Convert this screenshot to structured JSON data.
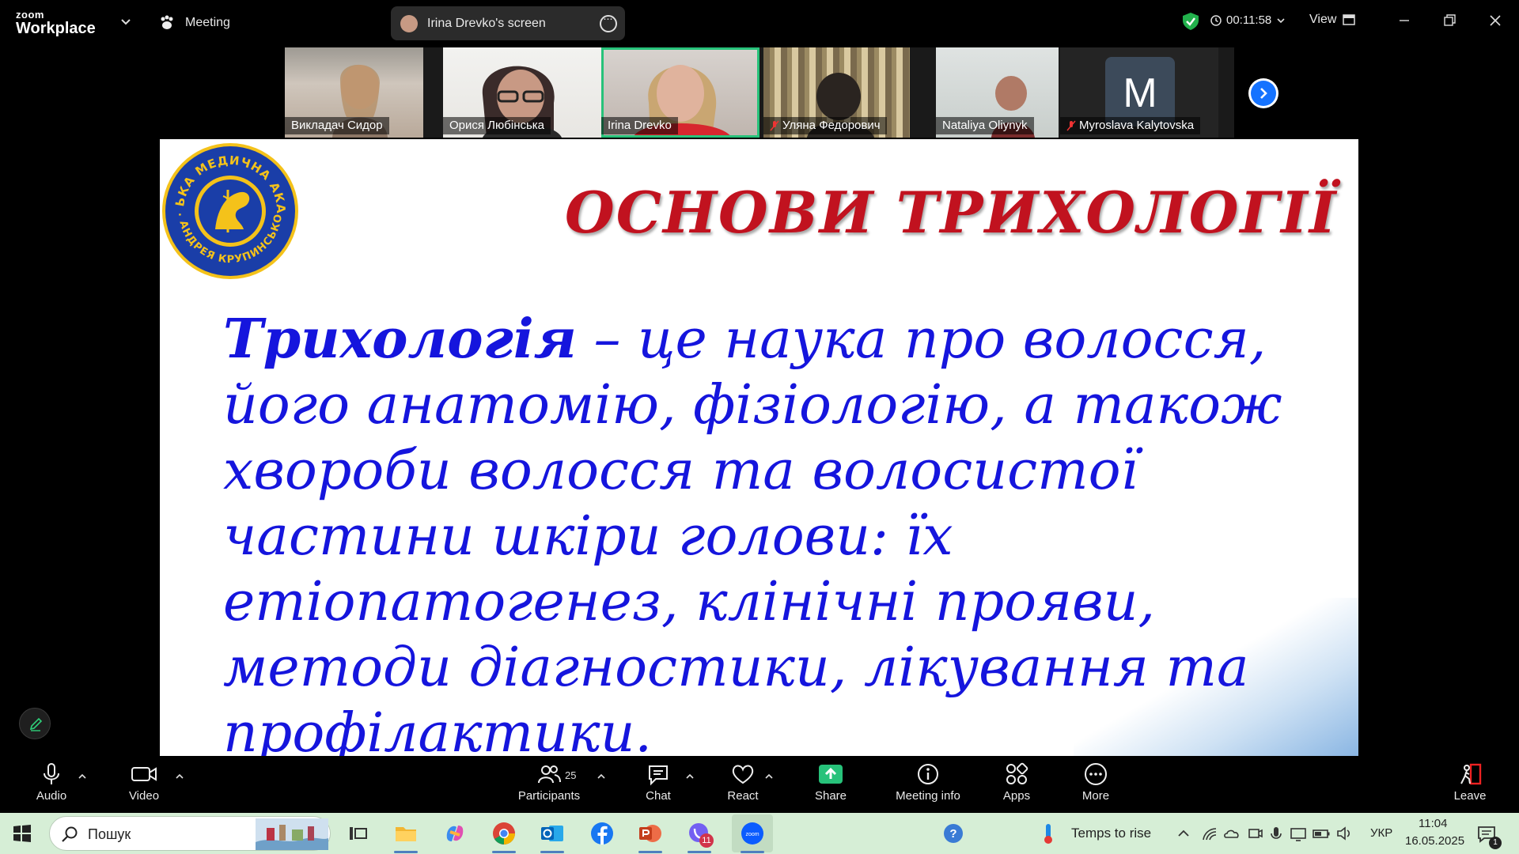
{
  "app": {
    "brand_small": "zoom",
    "brand_big": "Workplace"
  },
  "topbar": {
    "meeting_label": "Meeting",
    "screen_share_label": "Irina Drevko's screen",
    "timer": "00:11:58",
    "view_label": "View"
  },
  "participants_strip": [
    {
      "name": "Викладач Сидор",
      "muted": false,
      "active": false
    },
    {
      "name": "Орися Любінська",
      "muted": false,
      "active": false
    },
    {
      "name": "Irina Drevko",
      "muted": false,
      "active": true
    },
    {
      "name": "Уляна Федорович",
      "muted": true,
      "active": false
    },
    {
      "name": "Nataliya Oliynyk",
      "muted": false,
      "active": false
    },
    {
      "name": "Myroslava Kalytovska",
      "muted": true,
      "active": false,
      "avatar_letter": "M"
    }
  ],
  "slide": {
    "title": "ОСНОВИ ТРИХОЛОГІЇ",
    "term": "Трихологія",
    "definition_lines": [
      " –  це наука про волосся,",
      "його анатомію, фізіологію, а також",
      "хвороби волосся та волосистої",
      "частини шкіри голови: їх",
      "етіопатогенез, клінічні прояви,",
      "методи діагностики, лікування та",
      "профілактики."
    ],
    "seal_text_top": "ЛЬВІВСЬКА МЕДИЧНА АКАДЕМІЯ",
    "seal_text_bottom": "ІМ. АНДРЕЯ КРУПИНСЬКОГО",
    "colors": {
      "title": "#c1121f",
      "body": "#1515dd"
    }
  },
  "toolbar": {
    "audio": "Audio",
    "video": "Video",
    "participants": "Participants",
    "participants_count": "25",
    "chat": "Chat",
    "react": "React",
    "share": "Share",
    "meeting_info": "Meeting info",
    "apps": "Apps",
    "more": "More",
    "leave": "Leave"
  },
  "taskbar": {
    "search_placeholder": "Пошук",
    "weather": "Temps to rise",
    "language": "УКР",
    "time": "11:04",
    "date": "16.05.2025",
    "notification_count": "1",
    "badge_count": "11"
  },
  "accent_colors": {
    "zoom_blue": "#1573ff",
    "share_green": "#27c27a",
    "taskbar_bg": "#d6eed6"
  }
}
